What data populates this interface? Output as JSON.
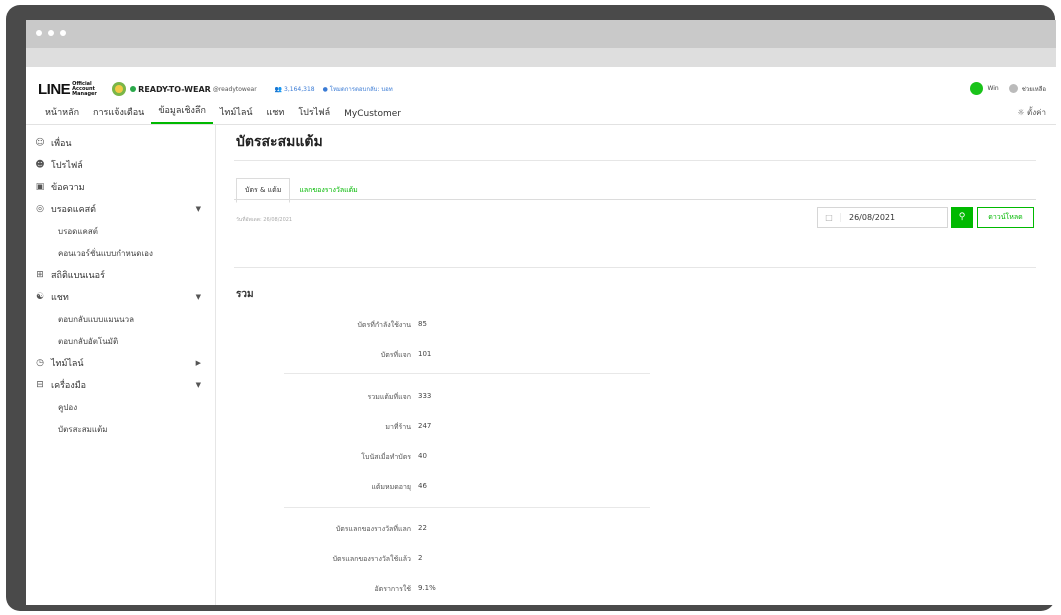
{
  "header": {
    "logo": "LINE",
    "logo_sub": "Official Account Manager",
    "account_name": "READY-TO-WEAR",
    "account_id": "@readytowear",
    "friends_count": "3,164,318",
    "plan_text": "โหมดการตอบกลับ: บอท",
    "user_name": "Win",
    "help_label": "ช่วยเหลือ"
  },
  "nav": {
    "tabs": [
      {
        "label": "หน้าหลัก"
      },
      {
        "label": "การแจ้งเตือน"
      },
      {
        "label": "ข้อมูลเชิงลึก"
      },
      {
        "label": "ไทม์ไลน์"
      },
      {
        "label": "แชท"
      },
      {
        "label": "โปรไฟล์"
      },
      {
        "label": "MyCustomer"
      }
    ],
    "settings_label": "ตั้งค่า"
  },
  "sidebar": {
    "items": [
      {
        "label": "เพื่อน",
        "icon": "friends-icon"
      },
      {
        "label": "โปรไฟล์",
        "icon": "profile-icon"
      },
      {
        "label": "ข้อความ",
        "icon": "message-icon"
      },
      {
        "label": "บรอดแคสต์",
        "icon": "broadcast-icon"
      },
      {
        "label": "บรอดแคสต์"
      },
      {
        "label": "คอนเวอร์ชั่นแบบกำหนดเอง"
      },
      {
        "label": "สถิติแบนเนอร์",
        "icon": "stats-icon"
      },
      {
        "label": "แชท",
        "icon": "chat-icon"
      },
      {
        "label": "ตอบกลับแบบแมนนวล"
      },
      {
        "label": "ตอบกลับอัตโนมัติ"
      },
      {
        "label": "ไทม์ไลน์",
        "icon": "timeline-icon"
      },
      {
        "label": "เครื่องมือ",
        "icon": "tools-icon"
      },
      {
        "label": "คูปอง"
      },
      {
        "label": "บัตรสะสมแต้ม"
      }
    ]
  },
  "main": {
    "title": "บัตรสะสมแต้ม",
    "tabs": [
      {
        "label": "บัตร & แต้ม"
      },
      {
        "label": "แลกของรางวัลแต้ม"
      }
    ],
    "update_note": "วันที่อัพเดต: 26/08/2021",
    "date_value": "26/08/2021",
    "download_label": "ดาวน์โหลด",
    "summary_title": "รวม",
    "stats": [
      {
        "label": "บัตรที่กำลังใช้งาน",
        "value": "85"
      },
      {
        "label": "บัตรที่แจก",
        "value": "101"
      },
      {
        "label": "รวมแต้มที่แจก",
        "value": "333"
      },
      {
        "label": "มาที่ร้าน",
        "value": "247"
      },
      {
        "label": "โบนัสเมื่อทำบัตร",
        "value": "40"
      },
      {
        "label": "แต้มหมดอายุ",
        "value": "46"
      },
      {
        "label": "บัตรแลกของรางวัลที่แลก",
        "value": "22"
      },
      {
        "label": "บัตรแลกของรางวัลใช้แล้ว",
        "value": "2"
      },
      {
        "label": "อัตราการใช้",
        "value": "9.1%"
      }
    ]
  },
  "colors": {
    "brand_green": "#00b900",
    "frame": "#4a4a4a"
  }
}
